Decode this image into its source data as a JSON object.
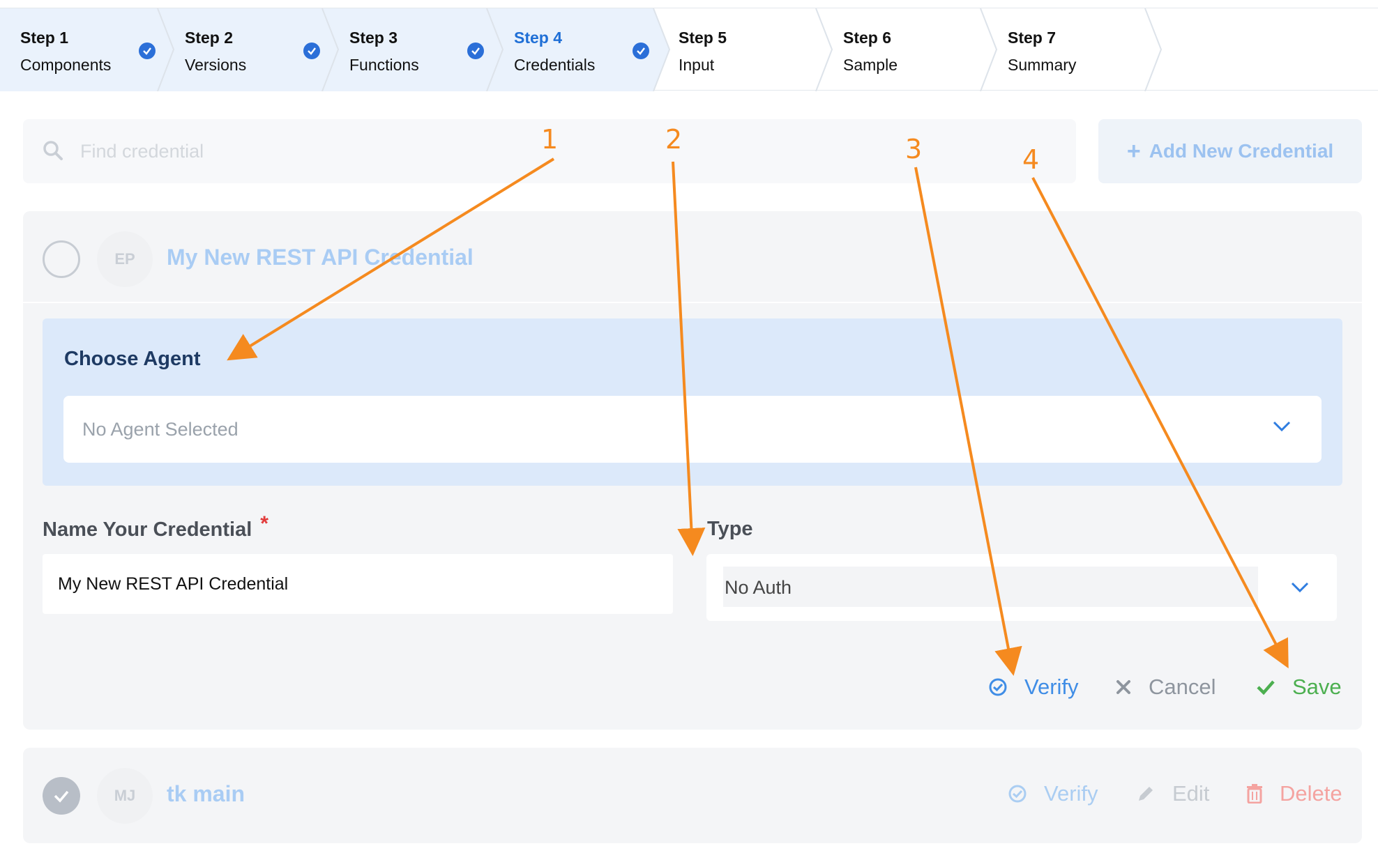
{
  "stepper": {
    "steps": [
      {
        "num": "Step 1",
        "label": "Components",
        "done": true
      },
      {
        "num": "Step 2",
        "label": "Versions",
        "done": true
      },
      {
        "num": "Step 3",
        "label": "Functions",
        "done": true
      },
      {
        "num": "Step 4",
        "label": "Credentials",
        "done": true,
        "active": true
      },
      {
        "num": "Step 5",
        "label": "Input",
        "done": false
      },
      {
        "num": "Step 6",
        "label": "Sample",
        "done": false
      },
      {
        "num": "Step 7",
        "label": "Summary",
        "done": false
      }
    ]
  },
  "search": {
    "placeholder": "Find credential",
    "value": ""
  },
  "add_button": {
    "plus": "+",
    "label": "Add New Credential"
  },
  "credential_edit": {
    "avatar": "EP",
    "title": "My New REST API Credential",
    "agent_heading": "Choose Agent",
    "agent_value": "No Agent Selected",
    "name_label": "Name Your Credential",
    "required_mark": "*",
    "name_value": "My New REST API Credential",
    "type_label": "Type",
    "type_value": "No Auth",
    "actions": {
      "verify": "Verify",
      "cancel": "Cancel",
      "save": "Save"
    }
  },
  "credential_saved": {
    "avatar": "MJ",
    "title": "tk main",
    "actions": {
      "verify": "Verify",
      "edit": "Edit",
      "delete": "Delete"
    }
  },
  "annotations": [
    "1",
    "2",
    "3",
    "4"
  ],
  "colors": {
    "primary": "#2b6fd8",
    "save_green": "#4caf50",
    "delete_red": "#f28b82",
    "annotation_orange": "#f58a1f"
  }
}
